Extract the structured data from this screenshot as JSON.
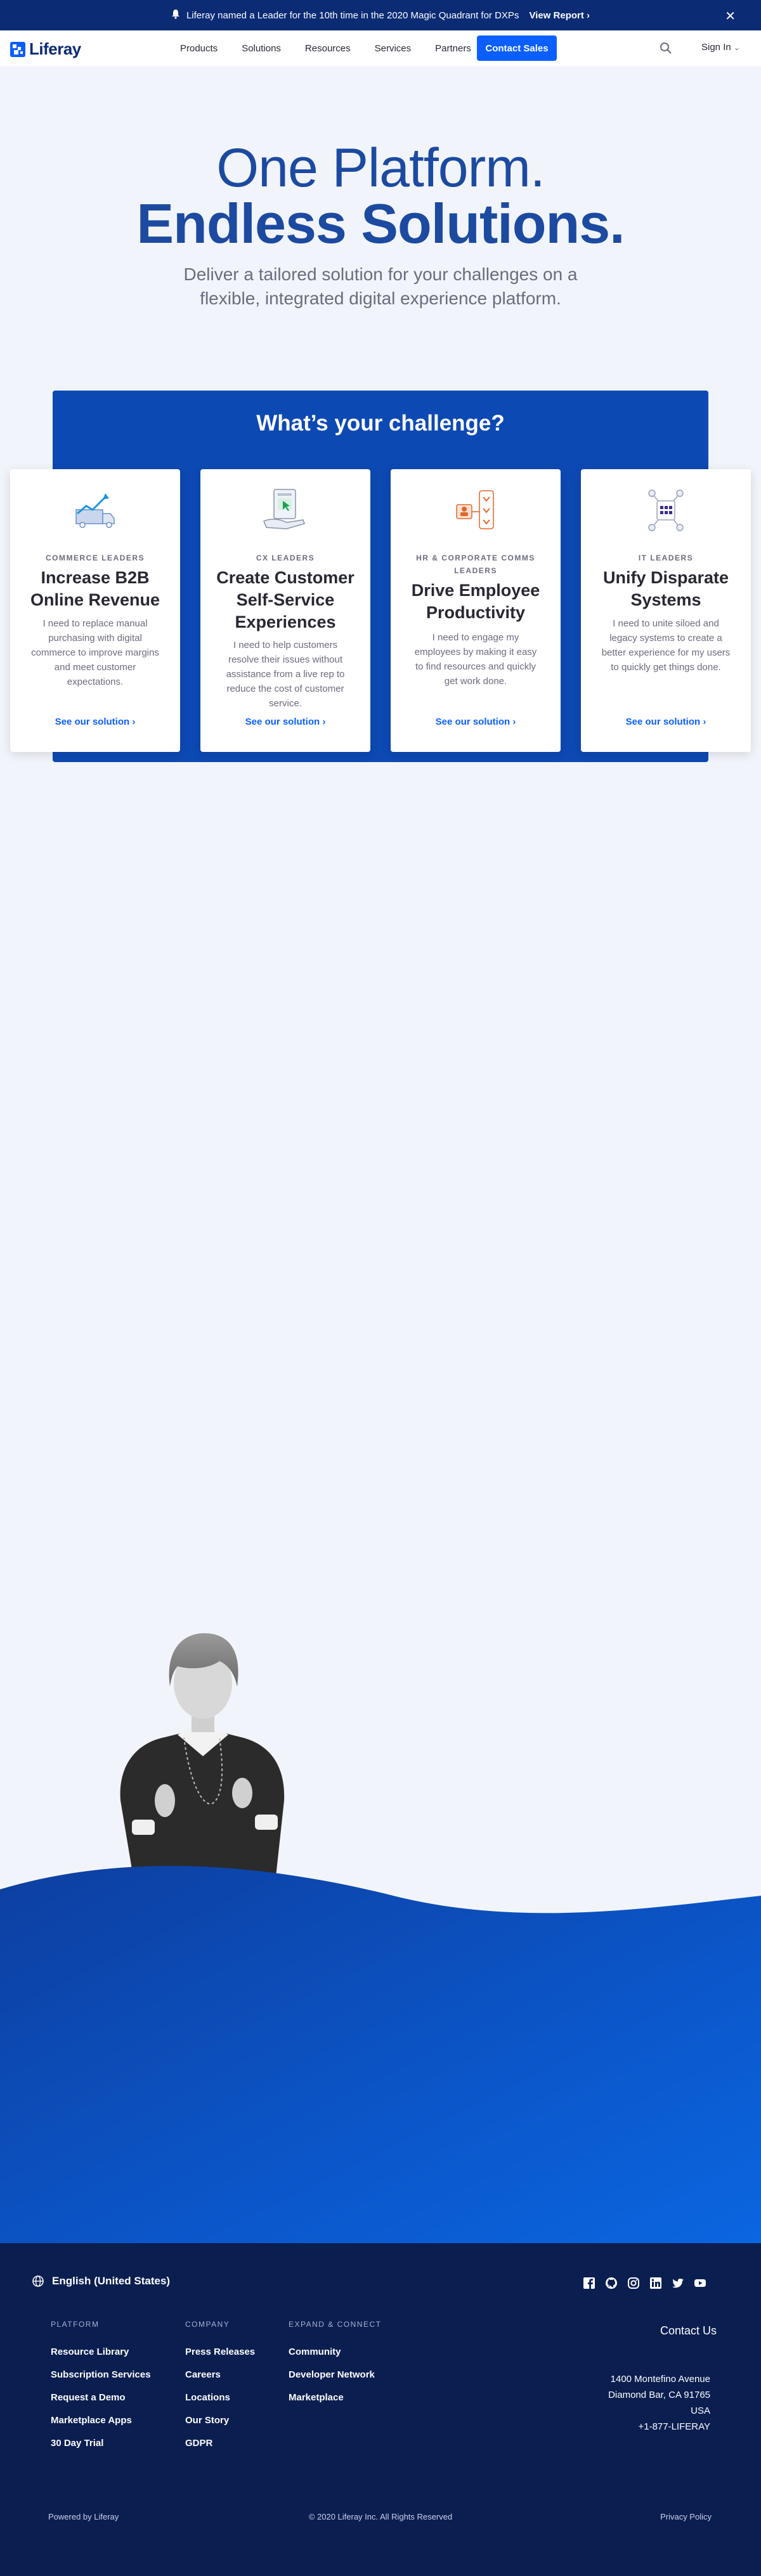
{
  "announcement": {
    "text": "Liferay named a Leader for the 10th time in the 2020 Magic Quadrant for DXPs",
    "link": "View Report"
  },
  "header": {
    "logo_text": "Liferay",
    "nav": [
      "Products",
      "Solutions",
      "Resources",
      "Services",
      "Partners"
    ],
    "cta": "Contact Sales",
    "sign_in": "Sign In"
  },
  "hero": {
    "title_line1": "One Platform.",
    "title_line2": "Endless Solutions.",
    "subtitle": "Deliver a tailored solution for your challenges on a flexible, integrated digital experience platform."
  },
  "challenge": {
    "title": "What’s your challenge?",
    "cards": [
      {
        "label": "COMMERCE LEADERS",
        "title": "Increase B2B Online Revenue",
        "desc": "I need to replace manual purchasing with digital commerce to improve margins and meet customer expectations.",
        "link": "See our solution"
      },
      {
        "label": "CX LEADERS",
        "title": "Create Customer Self-Service Experiences",
        "desc": "I need to help customers resolve their issues without assistance from a live rep to reduce the cost of customer service.",
        "link": "See our solution"
      },
      {
        "label": "HR & CORPORATE COMMS LEADERS",
        "title": "Drive Employee Productivity",
        "desc": "I need to engage my employees by making it easy to find resources and quickly get work done.",
        "link": "See our solution"
      },
      {
        "label": "IT LEADERS",
        "title": "Unify Disparate Systems",
        "desc": "I need to unite siloed and legacy systems to create a better experience for my users to quickly get things done.",
        "link": "See our solution"
      }
    ]
  },
  "footer": {
    "language": "English (United States)",
    "socials": [
      "facebook-icon",
      "github-icon",
      "instagram-icon",
      "linkedin-icon",
      "twitter-icon",
      "youtube-icon"
    ],
    "columns": [
      {
        "heading": "PLATFORM",
        "items": [
          "Resource Library",
          "Subscription Services",
          "Request a Demo",
          "Marketplace Apps",
          "30 Day Trial"
        ]
      },
      {
        "heading": "COMPANY",
        "items": [
          "Press Releases",
          "Careers",
          "Locations",
          "Our Story",
          "GDPR"
        ]
      },
      {
        "heading": "EXPAND & CONNECT",
        "items": [
          "Community",
          "Developer Network",
          "Marketplace"
        ]
      }
    ],
    "contact_us": "Contact Us",
    "address": [
      "1400 Montefino Avenue",
      "Diamond Bar, CA 91765",
      "USA",
      "+1-877-LIFERAY"
    ],
    "powered_by": "Powered by Liferay",
    "copyright": "© 2020 Liferay Inc. All Rights Reserved",
    "privacy": "Privacy Policy"
  },
  "colors": {
    "brand_dark": "#0b2b75",
    "accent": "#0b5fff",
    "panel": "#0d49b3",
    "footer": "#0b1e50"
  }
}
